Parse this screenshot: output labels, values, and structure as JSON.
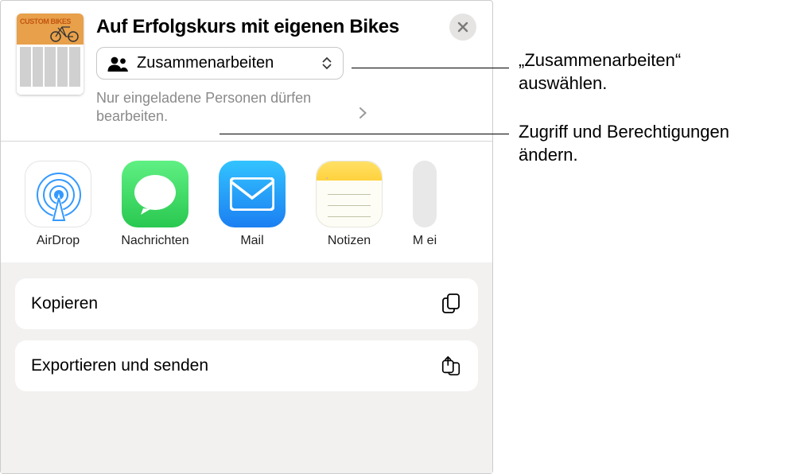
{
  "document": {
    "title": "Auf Erfolgskurs mit eigenen Bikes",
    "thumb_label": "CUSTOM\nBIKES"
  },
  "collaboration": {
    "mode_label": "Zusammenarbeiten",
    "permissions_text": "Nur eingeladene Personen dürfen bearbeiten."
  },
  "share_apps": [
    {
      "id": "airdrop",
      "label": "AirDrop",
      "icon": "airdrop-icon"
    },
    {
      "id": "messages",
      "label": "Nachrichten",
      "icon": "messages-icon"
    },
    {
      "id": "mail",
      "label": "Mail",
      "icon": "mail-icon"
    },
    {
      "id": "notes",
      "label": "Notizen",
      "icon": "notes-icon"
    },
    {
      "id": "more",
      "label": "M\nei",
      "icon": "more-icon"
    }
  ],
  "actions": [
    {
      "id": "copy",
      "label": "Kopieren",
      "icon": "copy-icon"
    },
    {
      "id": "export",
      "label": "Exportieren und senden",
      "icon": "share-multi-icon"
    }
  ],
  "callouts": [
    {
      "id": "collab-callout",
      "text": "„Zusammenarbeiten“ auswählen."
    },
    {
      "id": "perm-callout",
      "text": "Zugriff und Berechtigungen ändern."
    }
  ],
  "colors": {
    "messages_bg": "#41d965",
    "mail_bg_top": "#33c3ff",
    "mail_bg_bottom": "#1b7ff2",
    "notes_paper": "#fdfdf6",
    "close_bg": "#e6e4e2"
  }
}
